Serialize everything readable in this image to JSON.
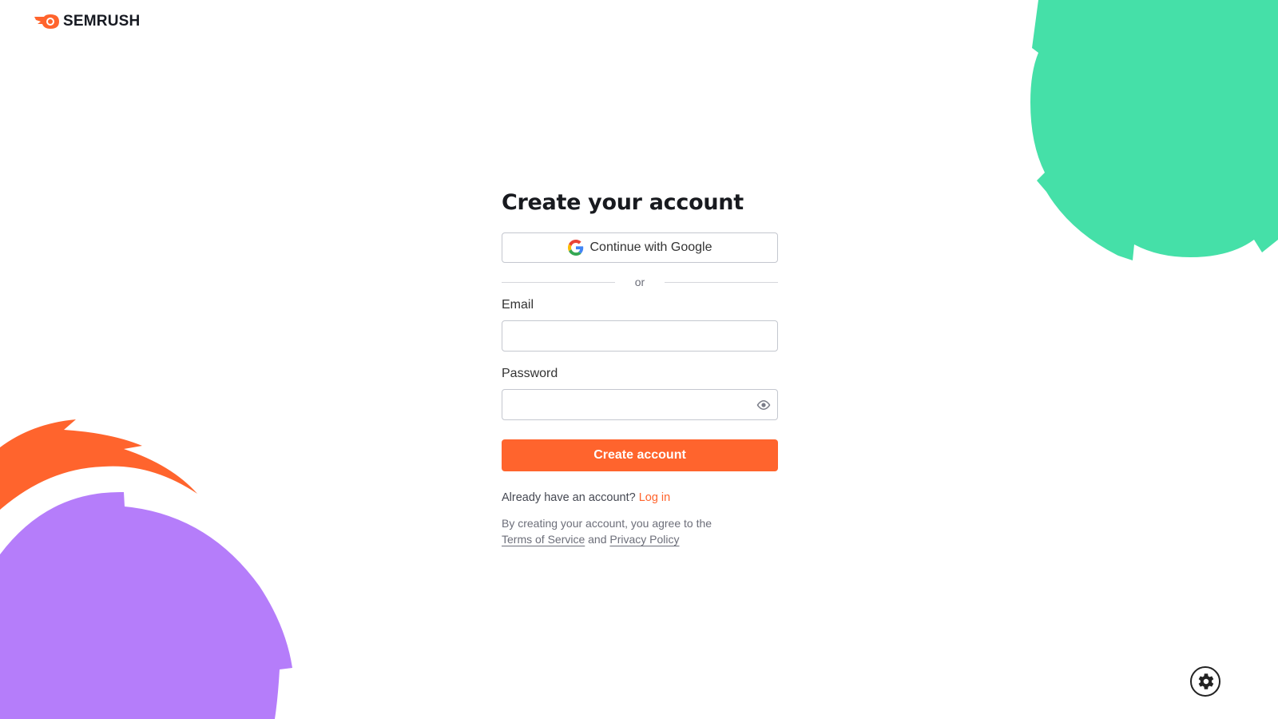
{
  "brand": {
    "name": "SEMRUSH",
    "accent": "#ff642d"
  },
  "form": {
    "title": "Create your account",
    "google_label": "Continue with Google",
    "divider": "or",
    "email_label": "Email",
    "email_value": "",
    "password_label": "Password",
    "password_value": "",
    "submit_label": "Create account",
    "already_text": "Already have an account?",
    "login_link": "Log in",
    "legal_text": "By creating your account, you agree to the",
    "terms_link": "Terms of Service",
    "and_text": "and",
    "privacy_link": "Privacy Policy"
  },
  "icons": {
    "google": "google-g-icon",
    "password_toggle": "eye-icon",
    "settings": "gear-icon"
  },
  "decor_colors": {
    "green": "#45e0a8",
    "orange": "#ff642d",
    "purple": "#b57dfa"
  }
}
